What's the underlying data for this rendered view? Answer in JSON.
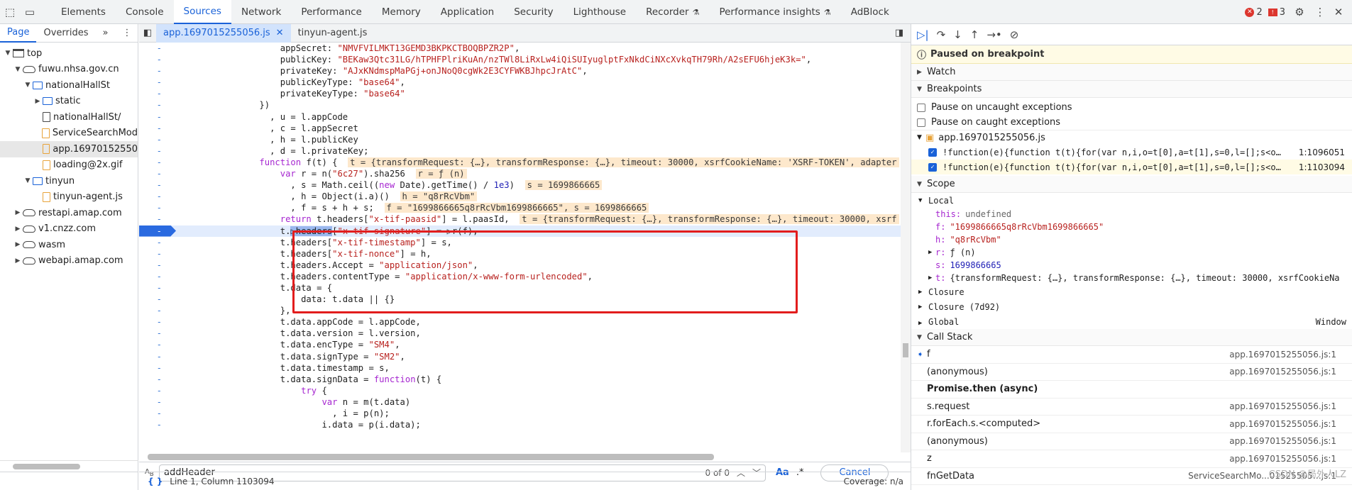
{
  "toolbar": {
    "tabs": [
      "Elements",
      "Console",
      "Sources",
      "Network",
      "Performance",
      "Memory",
      "Application",
      "Security",
      "Lighthouse",
      "Recorder",
      "Performance insights",
      "AdBlock"
    ],
    "active": "Sources",
    "errors": "2",
    "warnings": "3"
  },
  "navigator": {
    "tabs": [
      "Page",
      "Overrides"
    ],
    "more": "»",
    "tree": [
      {
        "label": "top",
        "depth": 0,
        "icon": "window",
        "arrow": "▼"
      },
      {
        "label": "fuwu.nhsa.gov.cn",
        "depth": 1,
        "icon": "cloud",
        "arrow": "▼"
      },
      {
        "label": "nationalHallSt",
        "depth": 2,
        "icon": "folder",
        "arrow": "▼"
      },
      {
        "label": "static",
        "depth": 3,
        "icon": "folder",
        "arrow": "▶"
      },
      {
        "label": "nationalHallSt/",
        "depth": 3,
        "icon": "file",
        "arrow": ""
      },
      {
        "label": "ServiceSearchMod",
        "depth": 3,
        "icon": "jsfile",
        "arrow": ""
      },
      {
        "label": "app.16970152550",
        "depth": 3,
        "icon": "jsfile",
        "arrow": "",
        "selected": true
      },
      {
        "label": "loading@2x.gif",
        "depth": 3,
        "icon": "jsfile",
        "arrow": ""
      },
      {
        "label": "tinyun",
        "depth": 2,
        "icon": "folder",
        "arrow": "▼"
      },
      {
        "label": "tinyun-agent.js",
        "depth": 3,
        "icon": "jsfile",
        "arrow": ""
      },
      {
        "label": "restapi.amap.com",
        "depth": 1,
        "icon": "cloud",
        "arrow": "▶"
      },
      {
        "label": "v1.cnzz.com",
        "depth": 1,
        "icon": "cloud",
        "arrow": "▶"
      },
      {
        "label": "wasm",
        "depth": 1,
        "icon": "cloud",
        "arrow": "▶"
      },
      {
        "label": "webapi.amap.com",
        "depth": 1,
        "icon": "cloud",
        "arrow": "▶"
      }
    ]
  },
  "editor": {
    "tabs": [
      "app.1697015255056.js",
      "tinyun-agent.js"
    ],
    "active": "app.1697015255056.js",
    "lines": [
      {
        "g": "-",
        "html": "                    appSecret: <span class=\"str\">\"NMVFVILMKT13GEMD3BKPKCTBOQBPZR2P\"</span>,"
      },
      {
        "g": "-",
        "html": "                    publicKey: <span class=\"str\">\"BEKaw3Qtc31LG/hTPHFPlriKuAn/nzTWl8LiRxLw4iQiSUIyuglptFxNkdCiNXcXvkqTH79Rh/A2sEFU6hjeK3k=\"</span>,"
      },
      {
        "g": "-",
        "html": "                    privateKey: <span class=\"str\">\"AJxKNdmspMaPGj+onJNoQ0cgWk2E3CYFWKBJhpcJrAtC\"</span>,"
      },
      {
        "g": "-",
        "html": "                    publicKeyType: <span class=\"str\">\"base64\"</span>,"
      },
      {
        "g": "-",
        "html": "                    privateKeyType: <span class=\"str\">\"base64\"</span>"
      },
      {
        "g": "-",
        "html": "                })"
      },
      {
        "g": "-",
        "html": "                  , u = l.appCode"
      },
      {
        "g": "-",
        "html": "                  , c = l.appSecret"
      },
      {
        "g": "-",
        "html": "                  , h = l.publicKey"
      },
      {
        "g": "-",
        "html": "                  , d = l.privateKey;"
      },
      {
        "g": "-",
        "html": "                <span class=\"kw\">function</span> f(t) {  <span class=\"inl\">t = {transformRequest: {…}, transformResponse: {…}, timeout: 30000, xsrfCookieName: 'XSRF-TOKEN', adapter</span>"
      },
      {
        "g": "-",
        "html": "                    <span class=\"kw\">var</span> r = n(<span class=\"str\">\"6c27\"</span>).sha256  <span class=\"inl\">r = ƒ (n)</span>"
      },
      {
        "g": "-",
        "html": "                      , s = Math.ceil((<span class=\"kw\">new</span> Date).getTime() / <span class=\"num\">1e3</span>)  <span class=\"inl\">s = 1699866665</span>"
      },
      {
        "g": "-",
        "html": "                      , h = Object(i.a)()  <span class=\"inl\">h = \"q8rRcVbm\"</span>"
      },
      {
        "g": "-",
        "html": "                      , f = s + h + s;  <span class=\"inl\">f = \"1699866665q8rRcVbm1699866665\", s = 1699866665</span>"
      },
      {
        "g": "-",
        "html": "                    <span class=\"kw\">return</span> t.headers[<span class=\"str\">\"x-tif-paasid\"</span>] = l.paasId,  <span class=\"inl\">t = {transformRequest: {…}, transformResponse: {…}, timeout: 30000, xsrf</span>"
      },
      {
        "g": "-",
        "html": "                    t.<span style=\"background:#9bb8ee\">▷headers</span>[<span class=\"str\">\"x-tif-signature\"</span>] = ▷r(f),",
        "hl": true
      },
      {
        "g": "-",
        "html": "                    t.headers[<span class=\"str\">\"x-tif-timestamp\"</span>] = s,"
      },
      {
        "g": "-",
        "html": "                    t.headers[<span class=\"str\">\"x-tif-nonce\"</span>] = h,"
      },
      {
        "g": "-",
        "html": "                    t.headers.Accept = <span class=\"str\">\"application/json\"</span>,"
      },
      {
        "g": "-",
        "html": "                    t.headers.contentType = <span class=\"str\">\"application/x-www-form-urlencoded\"</span>,"
      },
      {
        "g": "-",
        "html": "                    t.data = {"
      },
      {
        "g": "-",
        "html": "                        data: t.data || {}"
      },
      {
        "g": "-",
        "html": "                    },"
      },
      {
        "g": "-",
        "html": "                    t.data.appCode = l.appCode,"
      },
      {
        "g": "-",
        "html": "                    t.data.version = l.version,"
      },
      {
        "g": "-",
        "html": "                    t.data.encType = <span class=\"str\">\"SM4\"</span>,"
      },
      {
        "g": "-",
        "html": "                    t.data.signType = <span class=\"str\">\"SM2\"</span>,"
      },
      {
        "g": "-",
        "html": "                    t.data.timestamp = s,"
      },
      {
        "g": "-",
        "html": "                    t.data.signData = <span class=\"kw\">function</span>(t) {"
      },
      {
        "g": "-",
        "html": "                        <span class=\"kw\">try</span> {"
      },
      {
        "g": "-",
        "html": "                            <span class=\"kw\">var</span> n = m(t.data)"
      },
      {
        "g": "-",
        "html": "                              , i = p(n);"
      },
      {
        "g": "-",
        "html": "                            i.data = p(i.data);"
      }
    ]
  },
  "search": {
    "value": "addHeader",
    "count": "0 of 0",
    "aa": "Aa",
    "regex": ".*",
    "cancel": "Cancel"
  },
  "status": {
    "position": "Line 1, Column 1103094",
    "coverage": "Coverage: n/a",
    "braces": "{ }"
  },
  "debugger": {
    "paused": "Paused on breakpoint",
    "watch": "Watch",
    "breakpoints": "Breakpoints",
    "pause_uncaught": "Pause on uncaught exceptions",
    "pause_caught": "Pause on caught exceptions",
    "bp_file": "app.1697015255056.js",
    "bps": [
      {
        "code": "!function(e){function t(t){for(var n,i,o=t[0],a=t[1],s=0,l=[];s<o…",
        "loc": "1:1096051"
      },
      {
        "code": "!function(e){function t(t){for(var n,i,o=t[0],a=t[1],s=0,l=[];s<o…",
        "loc": "1:1103094"
      }
    ],
    "scope": "Scope",
    "local": "Local",
    "locals": [
      {
        "k": "this:",
        "v": "undefined",
        "cls": "cm"
      },
      {
        "k": "f:",
        "v": "\"1699866665q8rRcVbm1699866665\"",
        "cls": "str"
      },
      {
        "k": "h:",
        "v": "\"q8rRcVbm\"",
        "cls": "str"
      },
      {
        "k": "r:",
        "v": "ƒ (n)",
        "cls": "var",
        "arrow": "▶"
      },
      {
        "k": "s:",
        "v": "1699866665",
        "cls": "num"
      },
      {
        "k": "t:",
        "v": "{transformRequest: {…}, transformResponse: {…}, timeout: 30000, xsrfCookieNa",
        "cls": "var",
        "arrow": "▶"
      }
    ],
    "closure": "Closure",
    "closure2": "Closure (7d92)",
    "global": "Global",
    "global_val": "Window",
    "callstack": "Call Stack",
    "frames": [
      {
        "name": "f",
        "loc": "app.1697015255056.js:1",
        "current": true
      },
      {
        "name": "(anonymous)",
        "loc": "app.1697015255056.js:1"
      },
      {
        "name": "Promise.then (async)",
        "loc": "",
        "async": true
      },
      {
        "name": "s.request",
        "loc": "app.1697015255056.js:1"
      },
      {
        "name": "r.forEach.s.<computed>",
        "loc": "app.1697015255056.js:1"
      },
      {
        "name": "(anonymous)",
        "loc": "app.1697015255056.js:1"
      },
      {
        "name": "z",
        "loc": "app.1697015255056.js:1"
      },
      {
        "name": "fnGetData",
        "loc": "ServiceSearchMo...01525505…js:1"
      }
    ],
    "watermark": "CSDN @局外人LZ"
  }
}
